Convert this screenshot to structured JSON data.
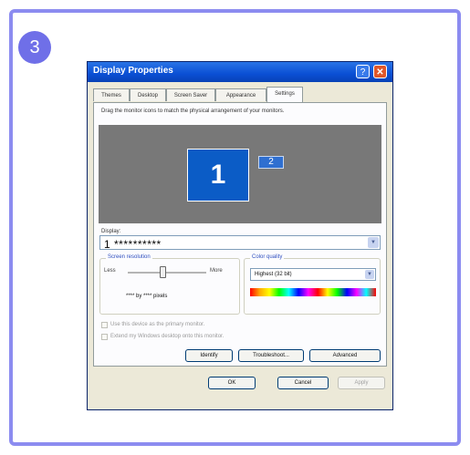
{
  "step": {
    "number": "3"
  },
  "dialog": {
    "title": "Display Properties",
    "help_glyph": "?",
    "close_glyph": "✕",
    "tabs": [
      {
        "label": "Themes"
      },
      {
        "label": "Desktop"
      },
      {
        "label": "Screen Saver"
      },
      {
        "label": "Appearance"
      },
      {
        "label": "Settings"
      }
    ],
    "active_tab": "Settings",
    "instruction": "Drag the monitor icons to match the physical arrangement of your monitors.",
    "monitors": {
      "primary": "1",
      "secondary": "2"
    },
    "display": {
      "label": "Display:",
      "value": "1 **********"
    },
    "resolution": {
      "group_label": "Screen resolution",
      "less_label": "Less",
      "more_label": "More",
      "value": "**** by **** pixels",
      "slider_fraction": 0.45
    },
    "color_quality": {
      "group_label": "Color quality",
      "value": "Highest (32 bit)"
    },
    "checkboxes": {
      "primary": "Use this device as the primary monitor.",
      "extend": "Extend my Windows desktop onto this monitor."
    },
    "buttons": {
      "identify": "Identify",
      "troubleshoot": "Troubleshoot...",
      "advanced": "Advanced",
      "ok": "OK",
      "cancel": "Cancel",
      "apply": "Apply"
    }
  },
  "colors": {
    "frame_border": "#8c8cf0",
    "step_badge": "#6f6fe8",
    "titlebar": "#0a4fd4",
    "monitor_primary": "#0b5cc6"
  }
}
